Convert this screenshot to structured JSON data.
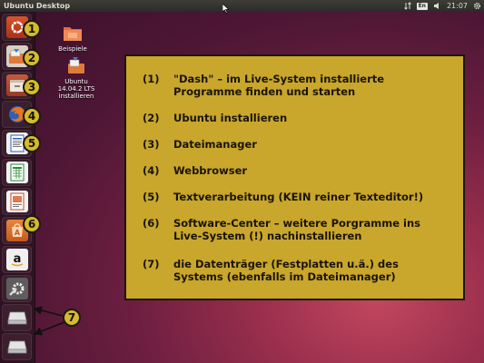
{
  "top_panel": {
    "title": "Ubuntu Desktop",
    "keyboard_layout": "En",
    "clock": "21:07"
  },
  "launcher": {
    "items": [
      {
        "name": "Dash",
        "icon": "ubuntu-logo-icon"
      },
      {
        "name": "Ubuntu installieren",
        "icon": "installer-icon"
      },
      {
        "name": "Dateimanager",
        "icon": "files-icon"
      },
      {
        "name": "Webbrowser",
        "icon": "firefox-icon"
      },
      {
        "name": "Textverarbeitung",
        "icon": "writer-icon"
      },
      {
        "name": "Tabellenkalkulation",
        "icon": "calc-icon"
      },
      {
        "name": "Präsentation",
        "icon": "impress-icon"
      },
      {
        "name": "Software-Center",
        "icon": "software-center-icon"
      },
      {
        "name": "Amazon",
        "icon": "amazon-icon"
      },
      {
        "name": "Systemeinstellungen",
        "icon": "settings-icon"
      },
      {
        "name": "Datenträger 1",
        "icon": "drive-icon"
      },
      {
        "name": "Datenträger 2",
        "icon": "drive-icon"
      }
    ]
  },
  "callouts": [
    "1",
    "2",
    "3",
    "4",
    "5",
    "6",
    "7"
  ],
  "desktop": {
    "icons": [
      {
        "label": "Beispiele"
      },
      {
        "label_line1": "Ubuntu 14.04.2 LTS",
        "label_line2": "installieren"
      }
    ]
  },
  "info": {
    "rows": [
      {
        "num": "(1)",
        "line1": "\"Dash\" – im Live-System installierte",
        "line2": "Programme finden und starten"
      },
      {
        "num": "(2)",
        "line1": "Ubuntu installieren"
      },
      {
        "num": "(3)",
        "line1": "Dateimanager"
      },
      {
        "num": "(4)",
        "line1": "Webbrowser"
      },
      {
        "num": "(5)",
        "line1": "Textverarbeitung (KEIN reiner Texteditor!)"
      },
      {
        "num": "(6)",
        "line1": "Software-Center – weitere Porgramme ins",
        "line2": "Live-System (!) nachinstallieren"
      },
      {
        "num": "(7)",
        "line1": "die Datenträger (Festplatten u.ä.) des",
        "line2": "Systems (ebenfalls im Dateimanager)"
      }
    ]
  },
  "colors": {
    "callout": "#d7b92d",
    "info_box": "#c9a62c",
    "wallpaper": "#6e1f41",
    "panel": "#2c2b28"
  }
}
